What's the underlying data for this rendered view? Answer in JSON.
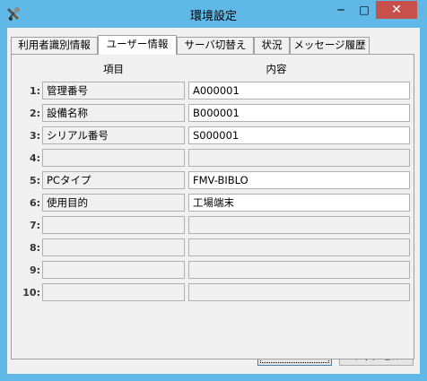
{
  "window": {
    "title": "環境設定",
    "min_glyph": "─",
    "max_glyph": "□",
    "close_glyph": "✕"
  },
  "tabs": [
    {
      "label": "利用者識別情報",
      "active": false
    },
    {
      "label": "ユーザー情報",
      "active": true
    },
    {
      "label": "サーバ切替え",
      "active": false
    },
    {
      "label": "状況",
      "active": false
    },
    {
      "label": "メッセージ履歴",
      "active": false
    }
  ],
  "table": {
    "col_item": "項目",
    "col_content": "内容",
    "rows": [
      {
        "num": "1:",
        "item": "管理番号",
        "value": "A000001"
      },
      {
        "num": "2:",
        "item": "設備名称",
        "value": "B000001"
      },
      {
        "num": "3:",
        "item": "シリアル番号",
        "value": "S000001"
      },
      {
        "num": "4:",
        "item": "",
        "value": ""
      },
      {
        "num": "5:",
        "item": "PCタイプ",
        "value": "FMV-BIBLO"
      },
      {
        "num": "6:",
        "item": "使用目的",
        "value": "工場端末"
      },
      {
        "num": "7:",
        "item": "",
        "value": ""
      },
      {
        "num": "8:",
        "item": "",
        "value": ""
      },
      {
        "num": "9:",
        "item": "",
        "value": ""
      },
      {
        "num": "10:",
        "item": "",
        "value": ""
      }
    ]
  },
  "buttons": {
    "ok": "OK",
    "cancel": "キャンセル"
  }
}
